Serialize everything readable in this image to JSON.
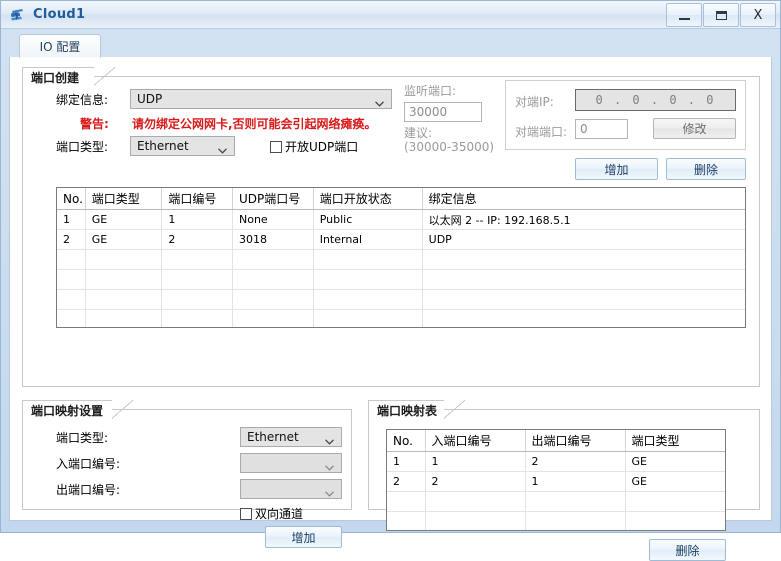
{
  "window": {
    "title": "Cloud1",
    "icon": "cloud-icon",
    "buttons": {
      "minimize": "—",
      "maximize": "❐",
      "close": "X"
    }
  },
  "tabs": [
    {
      "label": "IO 配置",
      "selected": true
    }
  ],
  "port_create": {
    "title": "端口创建",
    "binding_label": "绑定信息:",
    "binding_value": "UDP",
    "warning_label": "警告:",
    "warning_text": "请勿绑定公网网卡,否则可能会引起网络瘫痪。",
    "warning_color": "#d71a1a",
    "port_type_label": "端口类型:",
    "port_type_value": "Ethernet",
    "udp_checkbox_label": "开放UDP端口",
    "udp_checkbox_checked": false,
    "listen_port_label": "监听端口:",
    "listen_port_value": "30000",
    "suggest_label": "建议:",
    "suggest_range": "(30000-35000)",
    "peer_ip_label": "对端IP:",
    "peer_ip_value": "0 . 0 . 0 . 0",
    "peer_port_label": "对端端口:",
    "peer_port_value": "0",
    "modify_button": "修改",
    "add_button": "增加",
    "delete_button": "删除"
  },
  "port_table": {
    "headers": [
      "No.",
      "端口类型",
      "端口编号",
      "UDP端口号",
      "端口开放状态",
      "绑定信息"
    ],
    "rows": [
      [
        "1",
        "GE",
        "1",
        "None",
        "Public",
        "以太网 2 -- IP: 192.168.5.1"
      ],
      [
        "2",
        "GE",
        "2",
        "3018",
        "Internal",
        "UDP"
      ]
    ],
    "empty_rows": 6
  },
  "mapping_settings": {
    "title": "端口映射设置",
    "port_type_label": "端口类型:",
    "port_type_value": "Ethernet",
    "in_port_label": "入端口编号:",
    "in_port_value": "",
    "out_port_label": "出端口编号:",
    "out_port_value": "",
    "bidirectional_label": "双向通道",
    "bidirectional_checked": false,
    "add_button": "增加"
  },
  "mapping_table": {
    "title": "端口映射表",
    "headers": [
      "No.",
      "入端口编号",
      "出端口编号",
      "端口类型"
    ],
    "rows": [
      [
        "1",
        "1",
        "2",
        "GE"
      ],
      [
        "2",
        "2",
        "1",
        "GE"
      ]
    ],
    "empty_rows": 3,
    "delete_button": "删除"
  }
}
